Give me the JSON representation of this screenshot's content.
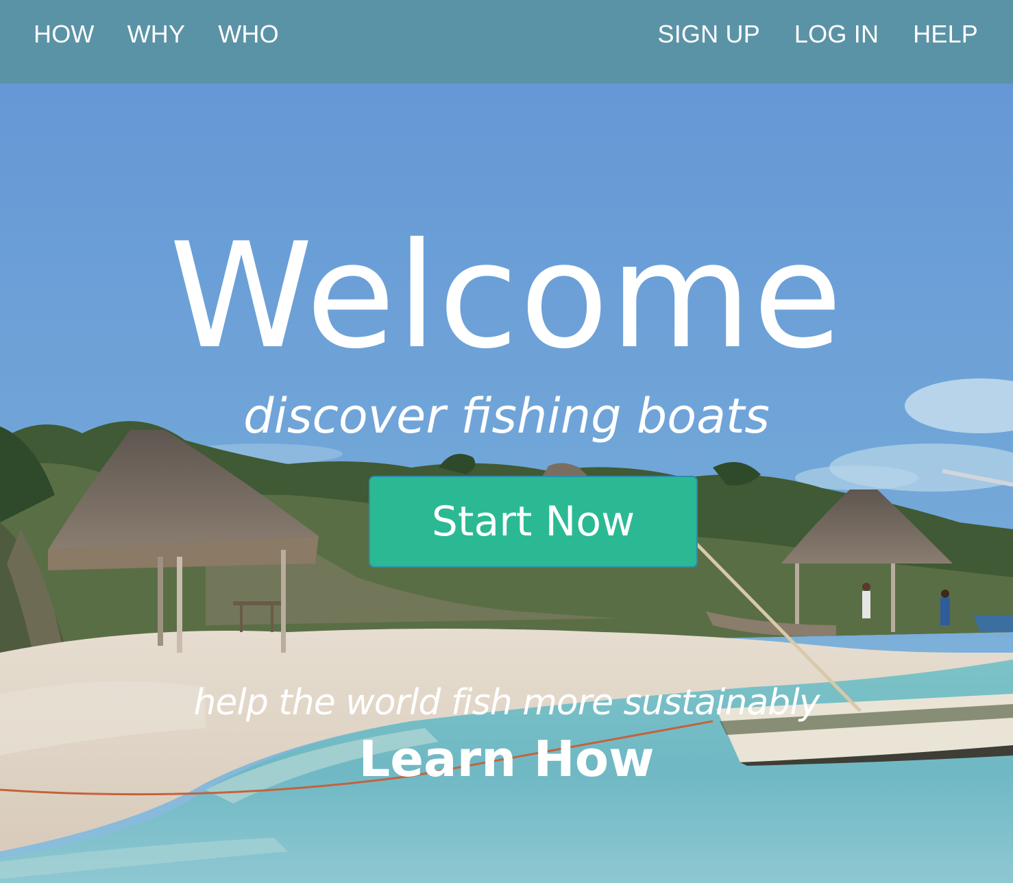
{
  "nav": {
    "left": [
      {
        "label": "HOW"
      },
      {
        "label": "WHY"
      },
      {
        "label": "WHO"
      }
    ],
    "right": [
      {
        "label": "SIGN UP"
      },
      {
        "label": "LOG IN"
      },
      {
        "label": "HELP"
      }
    ]
  },
  "hero": {
    "title": "Welcome",
    "tagline": "discover fishing boats",
    "cta_label": "Start Now",
    "subtext": "help the world fish more sustainably",
    "learn_link": "Learn How"
  },
  "colors": {
    "navbar": "#5b93a6",
    "cta": "#2bb993",
    "sky": "#6c9ed8",
    "text": "#ffffff"
  }
}
